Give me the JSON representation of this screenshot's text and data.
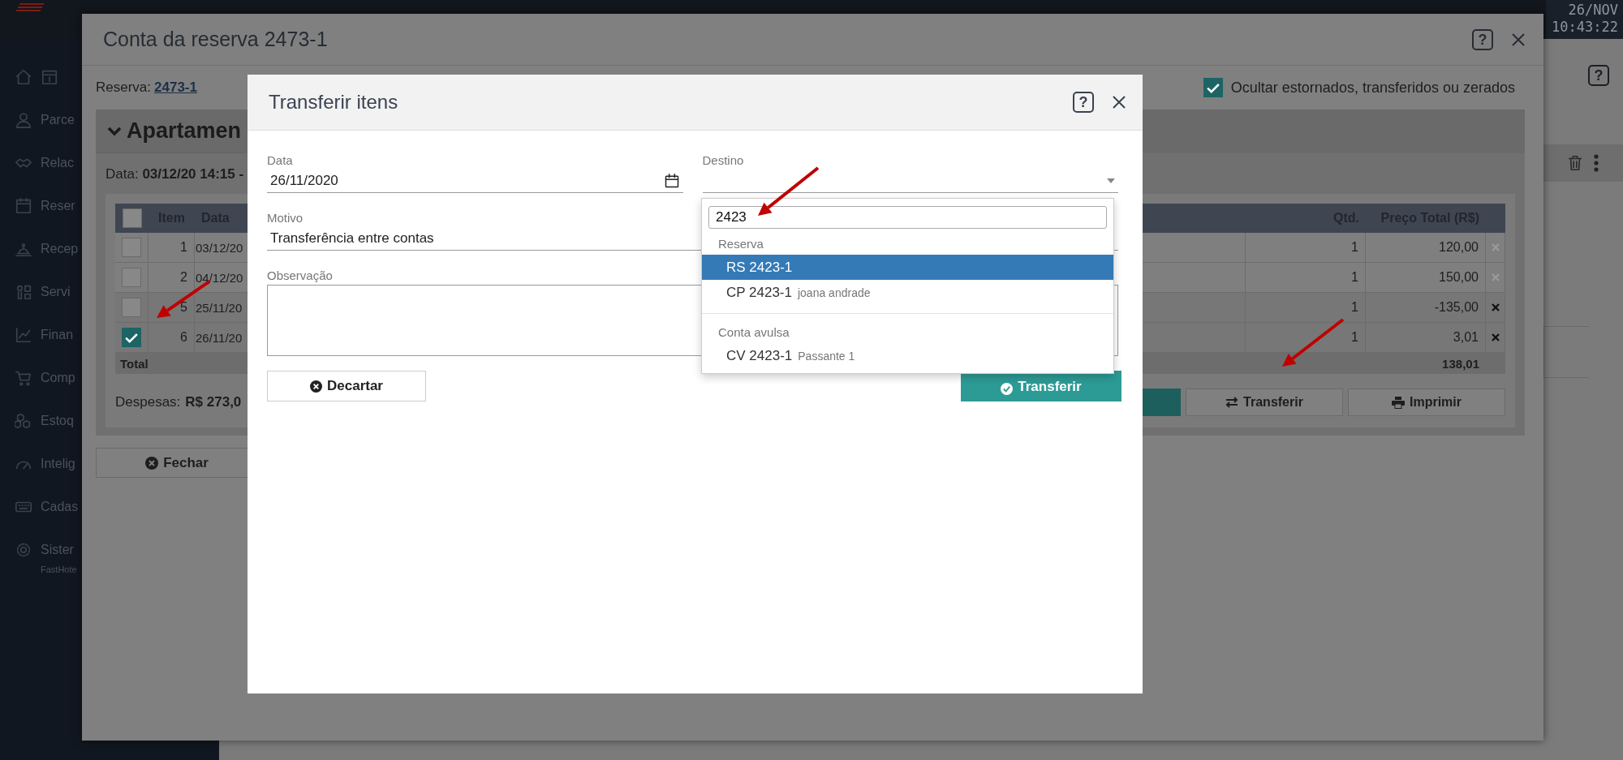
{
  "app": {
    "clock": {
      "date": "26/NOV",
      "time": "10:43:22"
    },
    "sidebar": {
      "items": [
        {
          "label": "Parce"
        },
        {
          "label": "Relac"
        },
        {
          "label": "Reser"
        },
        {
          "label": "Recep"
        },
        {
          "label": "Servi"
        },
        {
          "label": "Finan"
        },
        {
          "label": "Comp"
        },
        {
          "label": "Estoq"
        },
        {
          "label": "Intelig"
        },
        {
          "label": "Cadas"
        },
        {
          "label": "Sister"
        }
      ],
      "footer": "FastHote"
    },
    "help": "?"
  },
  "account_window": {
    "title": "Conta da reserva 2473-1",
    "help": "?",
    "reserva_label": "Reserva:",
    "reserva_link": "2473-1",
    "hide_option": {
      "label": "Ocultar estornados, transferidos ou zerados",
      "checked": true
    },
    "panel": {
      "title": "Apartamen",
      "expanded": true,
      "date_label": "Data:",
      "date_value": "03/12/20 14:15 -"
    },
    "table": {
      "select_all": {
        "checked": false
      },
      "columns": [
        "Item",
        "Data",
        "Qtd.",
        "Preço Total (R$)"
      ],
      "rows": [
        {
          "selected": false,
          "item": "1",
          "date": "03/12/20",
          "qty": "1",
          "total": "120,00",
          "removable": false
        },
        {
          "selected": false,
          "item": "2",
          "date": "04/12/20",
          "qty": "1",
          "total": "150,00",
          "removable": false
        },
        {
          "selected": false,
          "item": "5",
          "date": "25/11/20",
          "qty": "1",
          "total": "-135,00",
          "removable": true
        },
        {
          "selected": true,
          "item": "6",
          "date": "26/11/20",
          "qty": "1",
          "total": "3,01",
          "removable": true
        }
      ],
      "total": {
        "label": "Total",
        "value": "138,01"
      }
    },
    "expenses": {
      "label": "Despesas:",
      "value": "R$ 273,0"
    },
    "buttons": [
      {
        "kind": "primary"
      },
      {
        "kind": "transfer",
        "label": "Transferir"
      },
      {
        "kind": "print",
        "label": "Imprimir"
      }
    ],
    "close_button": "Fechar"
  },
  "transfer_dialog": {
    "title": "Transferir itens",
    "help": "?",
    "date": {
      "label": "Data",
      "value": "26/11/2020"
    },
    "destination": {
      "label": "Destino"
    },
    "reason": {
      "label": "Motivo",
      "value": "Transferência entre contas"
    },
    "note": {
      "label": "Observação"
    },
    "dropdown": {
      "search": "2423",
      "groups": [
        {
          "label": "Reserva",
          "options": [
            {
              "code": "RS 2423-1",
              "selected": true
            },
            {
              "code": "CP 2423-1",
              "detail": "joana andrade",
              "selected": false
            }
          ]
        },
        {
          "label": "Conta avulsa",
          "options": [
            {
              "code": "CV 2423-1",
              "detail": "Passante 1",
              "selected": false
            }
          ]
        }
      ]
    },
    "discard_button": "Decartar",
    "transfer_button": "Transferir"
  }
}
